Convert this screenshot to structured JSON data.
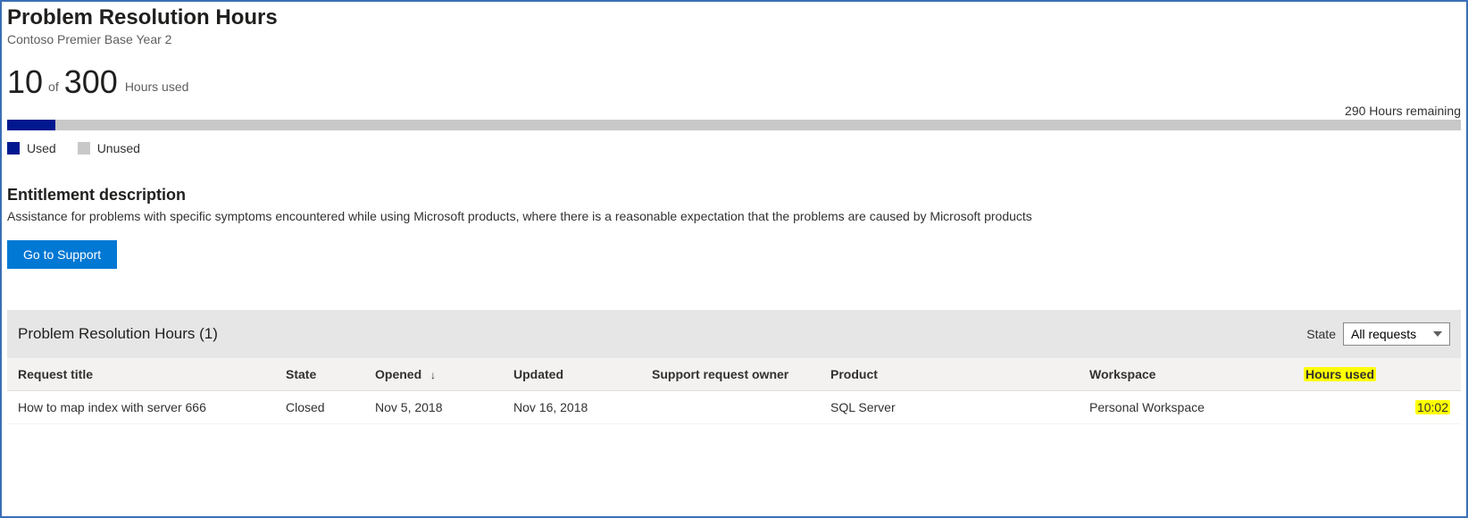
{
  "header": {
    "title": "Problem Resolution Hours",
    "subtitle": "Contoso Premier Base Year 2"
  },
  "usage": {
    "used": "10",
    "of_label": "of",
    "total": "300",
    "used_label": "Hours used",
    "remaining_text": "290 Hours remaining",
    "progress_percent": 3.33,
    "legend_used": "Used",
    "legend_unused": "Unused"
  },
  "entitlement": {
    "heading": "Entitlement description",
    "description": "Assistance for problems with specific symptoms encountered while using Microsoft products, where there is a reasonable expectation that the problems are caused by Microsoft products",
    "button_label": "Go to Support"
  },
  "requests_section": {
    "title": "Problem Resolution Hours (1)",
    "state_label": "State",
    "state_selected": "All requests",
    "columns": {
      "title": "Request title",
      "state": "State",
      "opened": "Opened",
      "updated": "Updated",
      "owner": "Support request owner",
      "product": "Product",
      "workspace": "Workspace",
      "hours_used": "Hours used"
    },
    "sort_indicator": "↓",
    "rows": [
      {
        "title": "How to map index with server 666",
        "state": "Closed",
        "opened": "Nov 5, 2018",
        "updated": "Nov 16, 2018",
        "owner": "",
        "product": "SQL Server",
        "workspace": "Personal Workspace",
        "hours_used": "10:02"
      }
    ]
  },
  "chart_data": {
    "type": "bar",
    "title": "Problem Resolution Hours usage",
    "categories": [
      "Used",
      "Unused"
    ],
    "values": [
      10,
      290
    ],
    "total": 300,
    "xlabel": "",
    "ylabel": "Hours",
    "ylim": [
      0,
      300
    ]
  }
}
